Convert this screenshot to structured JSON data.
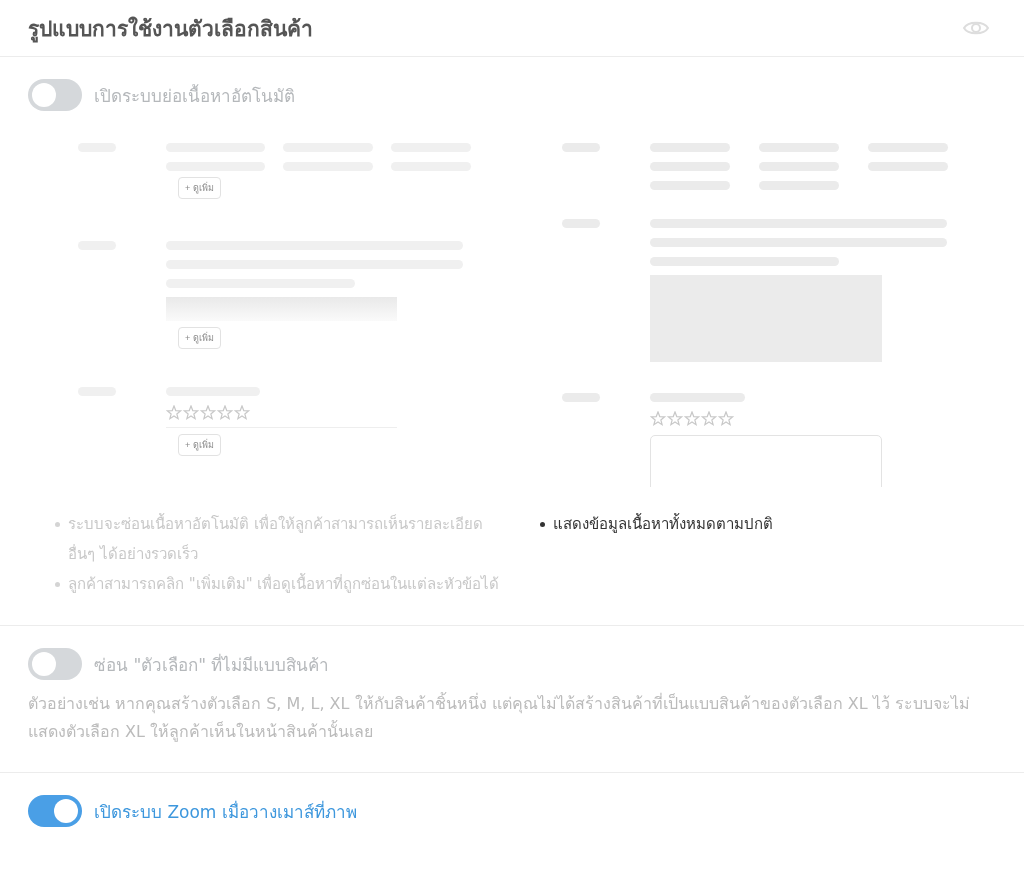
{
  "header": {
    "title": "รูปแบบการใช้งานตัวเลือกสินค้า"
  },
  "settings": [
    {
      "kind": "preview",
      "label": "เปิดระบบย่อเนื้อหาอัตโนมัติ",
      "on": false,
      "previews": [
        {
          "kind": "collapsed",
          "buttons": [
            "+ ดูเพิ่ม",
            "+ ดูเพิ่ม",
            "+ ดูเพิ่ม"
          ],
          "bullets": [
            "ระบบจะซ่อนเนื้อหาอัตโนมัติ เพื่อให้ลูกค้าสามารถเห็นรายละเอียดอื่นๆ ได้อย่างรวดเร็ว",
            "ลูกค้าสามารถคลิก \"เพิ่มเติม\" เพื่อดูเนื้อหาที่ถูกซ่อนในแต่ละหัวข้อได้"
          ]
        },
        {
          "kind": "full",
          "bullets": [
            "แสดงข้อมูลเนื้อหาทั้งหมดตามปกติ"
          ]
        }
      ]
    },
    {
      "kind": "description",
      "label": "ซ่อน \"ตัวเลือก\" ที่ไม่มีแบบสินค้า",
      "on": false,
      "description": "ตัวอย่างเช่น หากคุณสร้างตัวเลือก S, M, L, XL ให้กับสินค้าชิ้นหนึ่ง แต่คุณไม่ได้สร้างสินค้าที่เป็นแบบสินค้าของตัวเลือก XL ไว้ ระบบจะไม่แสดงตัวเลือก XL ให้ลูกค้าเห็นในหน้าสินค้านั้นเลย"
    },
    {
      "kind": "plain",
      "label": "เปิดระบบ Zoom เมื่อวางเมาส์ที่ภาพ",
      "on": true
    }
  ]
}
